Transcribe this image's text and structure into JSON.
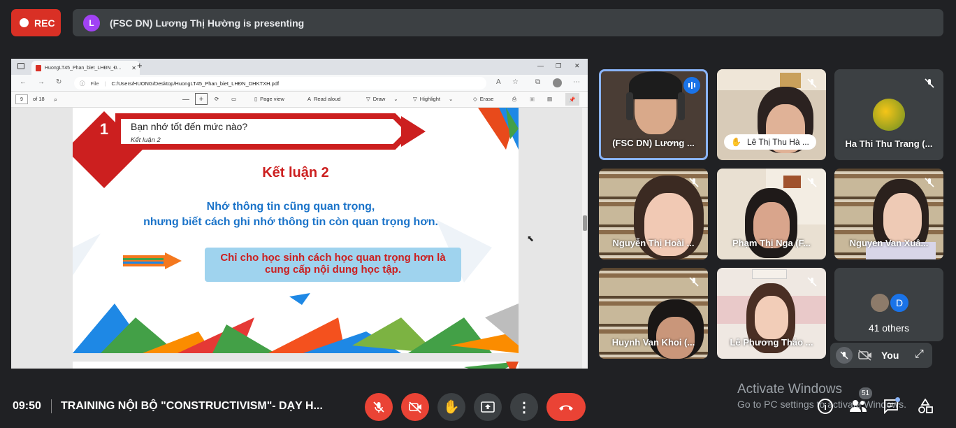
{
  "recording": {
    "label": "REC"
  },
  "presenter_bar": {
    "avatar_letter": "L",
    "text": "(FSC DN) Lương Thị Hường is presenting"
  },
  "browser": {
    "tab_title": "HuongLT45_Phan_biet_LHĐN_Đ...",
    "url_scheme": "File",
    "url": "C:/Users/HUONG/Desktop/HuongLT45_Phan_biet_LHĐN_DHKTXH.pdf",
    "page_number": "9",
    "page_total": "of 18",
    "toolbar": {
      "page_view": "Page view",
      "read_aloud": "Read aloud",
      "draw": "Draw",
      "highlight": "Highlight",
      "erase": "Erase"
    }
  },
  "slide": {
    "badge_number": "1",
    "header_title": "Bạn nhớ tốt đến mức nào?",
    "header_subtitle": "Kết luận 2",
    "heading": "Kết luận 2",
    "line1": "Nhớ thông tin cũng quan trọng,",
    "line2": "nhưng biết cách ghi nhớ thông tin còn quan trọng hơn.",
    "box_line1": "Chỉ cho học sinh cách học quan trọng hơn là",
    "box_line2": "cung cấp nội dung học tập."
  },
  "participants": [
    {
      "name": "(FSC DN) Lương ...",
      "state": "speaking"
    },
    {
      "name": "Lê Thị Thu Hà ...",
      "state": "hand-raised"
    },
    {
      "name": "Ha Thi Thu Trang (...",
      "state": "muted"
    },
    {
      "name": "Nguyễn Thị Hoài ...",
      "state": "muted"
    },
    {
      "name": "Phạm Thị Nga (F...",
      "state": "muted"
    },
    {
      "name": "Nguyen Van Xuâ...",
      "state": "muted"
    },
    {
      "name": "Huynh Van Khoi (...",
      "state": "muted"
    },
    {
      "name": "Lê Phương Thảo ...",
      "state": "muted"
    }
  ],
  "others": {
    "avatar_letter": "D",
    "label": "41 others"
  },
  "self_tile": {
    "label": "You"
  },
  "footer": {
    "time": "09:50",
    "meeting_title": "TRAINING NỘI BỘ \"CONSTRUCTIVISM\"- DẠY H...",
    "people_count": "51"
  },
  "watermark": {
    "line1": "Activate Windows",
    "line2": "Go to PC settings to activate Windows."
  },
  "colors": {
    "rec": "#d93025",
    "end_call": "#ea4335",
    "slide_red": "#cc1f1f",
    "slide_blue": "#1a73c9",
    "box_bg": "#9fd3ee"
  }
}
